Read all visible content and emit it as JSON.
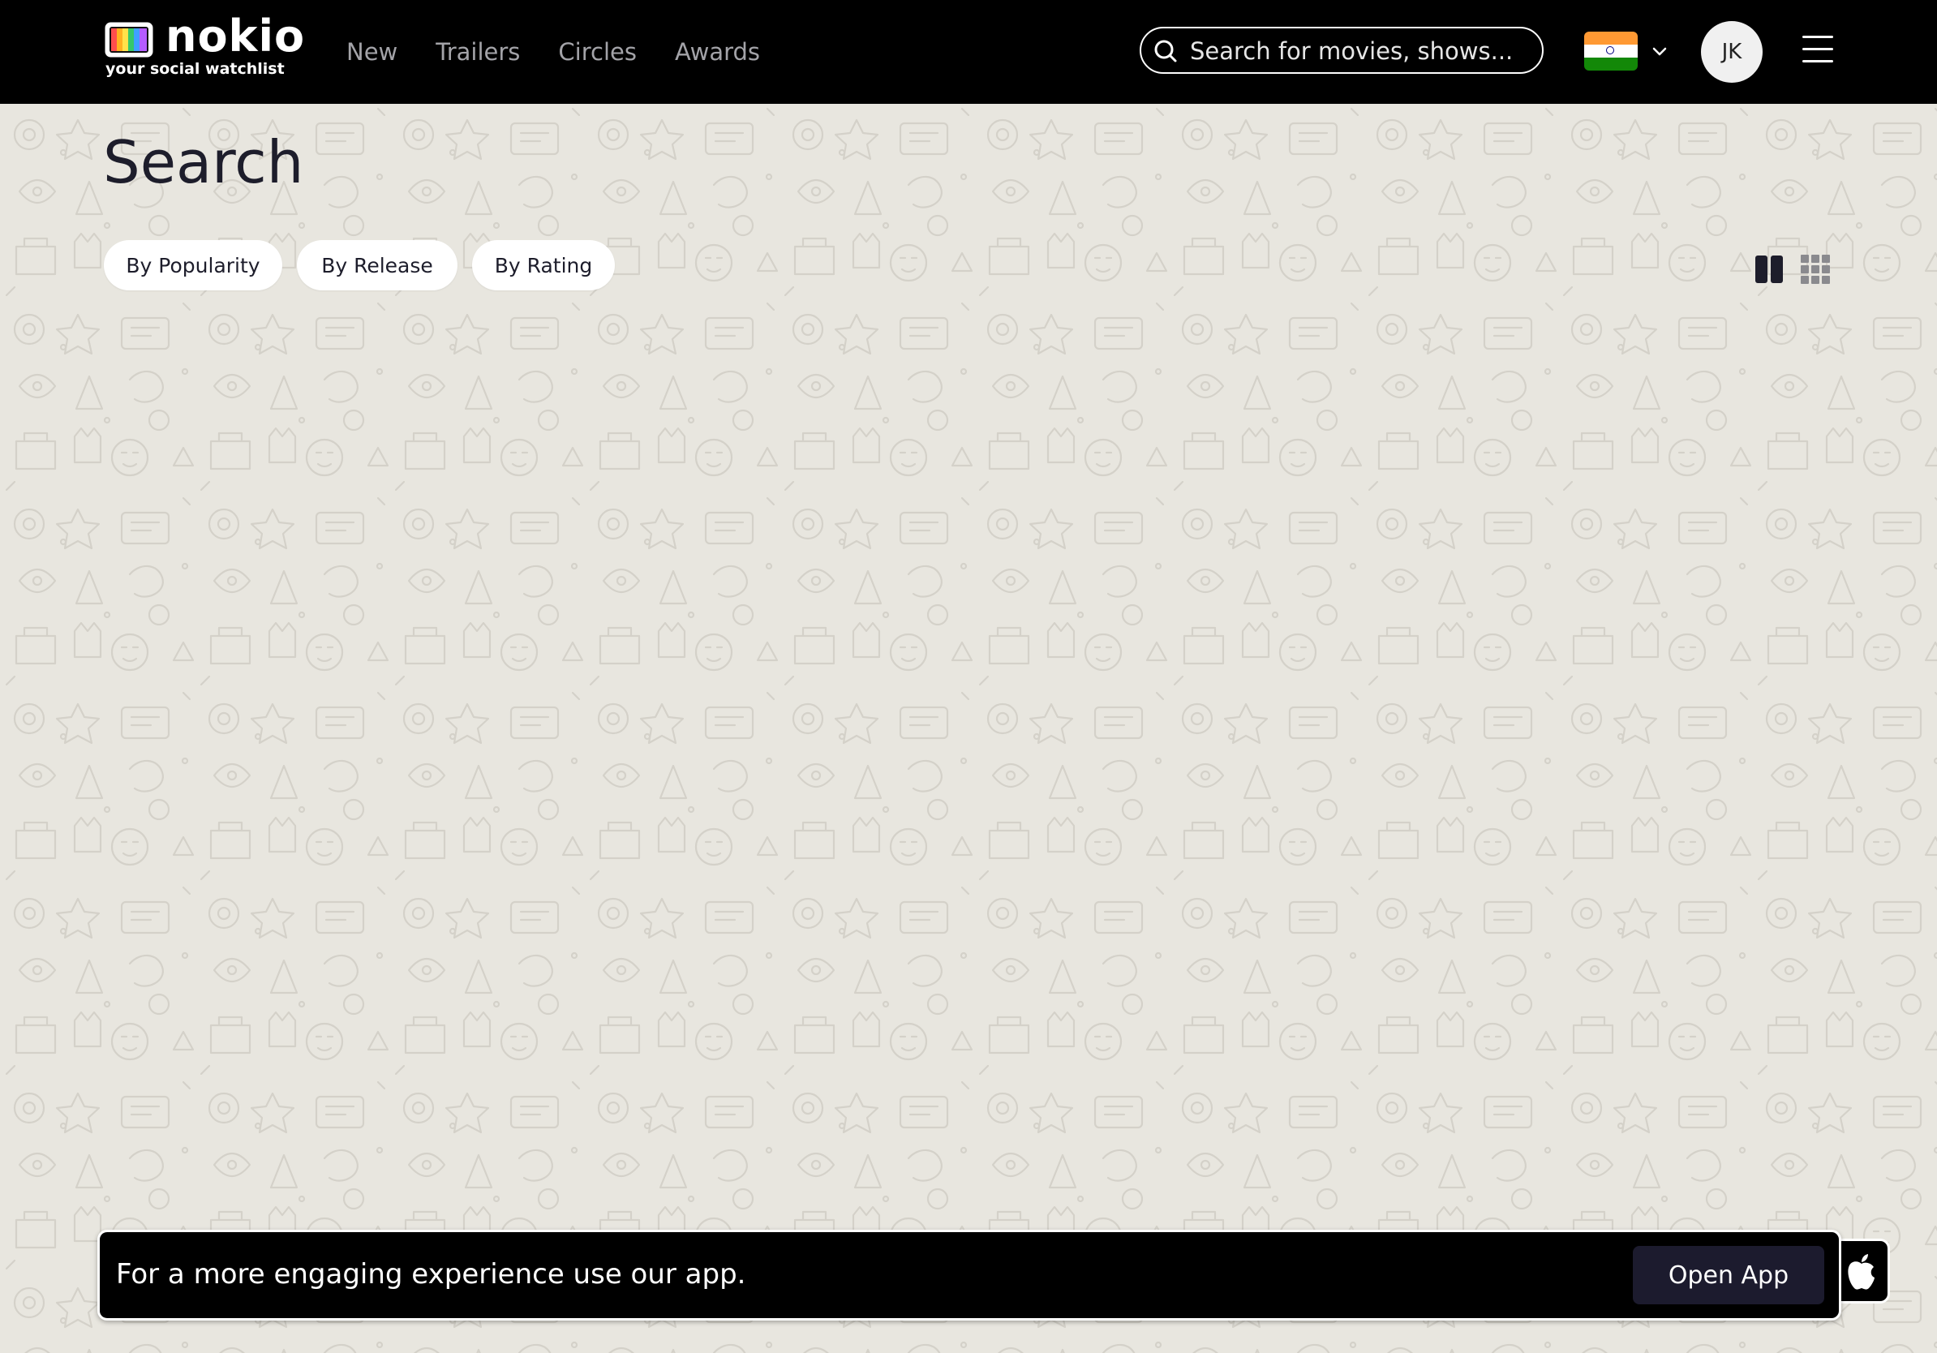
{
  "header": {
    "logo": {
      "wordmark": "nokio",
      "tagline": "your social watchlist"
    },
    "nav": [
      {
        "label": "New"
      },
      {
        "label": "Trailers"
      },
      {
        "label": "Circles"
      },
      {
        "label": "Awards"
      }
    ],
    "search": {
      "placeholder": "Search for movies, shows...",
      "value": "",
      "icon": "search-icon"
    },
    "region": {
      "country_flag": "India",
      "icon": "chevron-down-icon"
    },
    "avatar": {
      "initials": "JK"
    },
    "menu_icon": "hamburger-menu-icon"
  },
  "page": {
    "title": "Search",
    "sort_options": [
      {
        "label": "By Popularity"
      },
      {
        "label": "By Release"
      },
      {
        "label": "By Rating"
      }
    ],
    "view_toggles": [
      {
        "icon": "two-column-view-icon",
        "selected": true
      },
      {
        "icon": "grid-view-icon",
        "selected": false
      }
    ]
  },
  "app_banner": {
    "message": "For a more engaging experience use our app.",
    "button_label": "Open App",
    "store_icon": "apple-icon"
  },
  "colors": {
    "header_bg": "#000000",
    "page_bg": "#e8e6df",
    "nav_text": "#a3a3a8",
    "title_text": "#1d1d2b",
    "button_bg": "#1c1b2e"
  }
}
